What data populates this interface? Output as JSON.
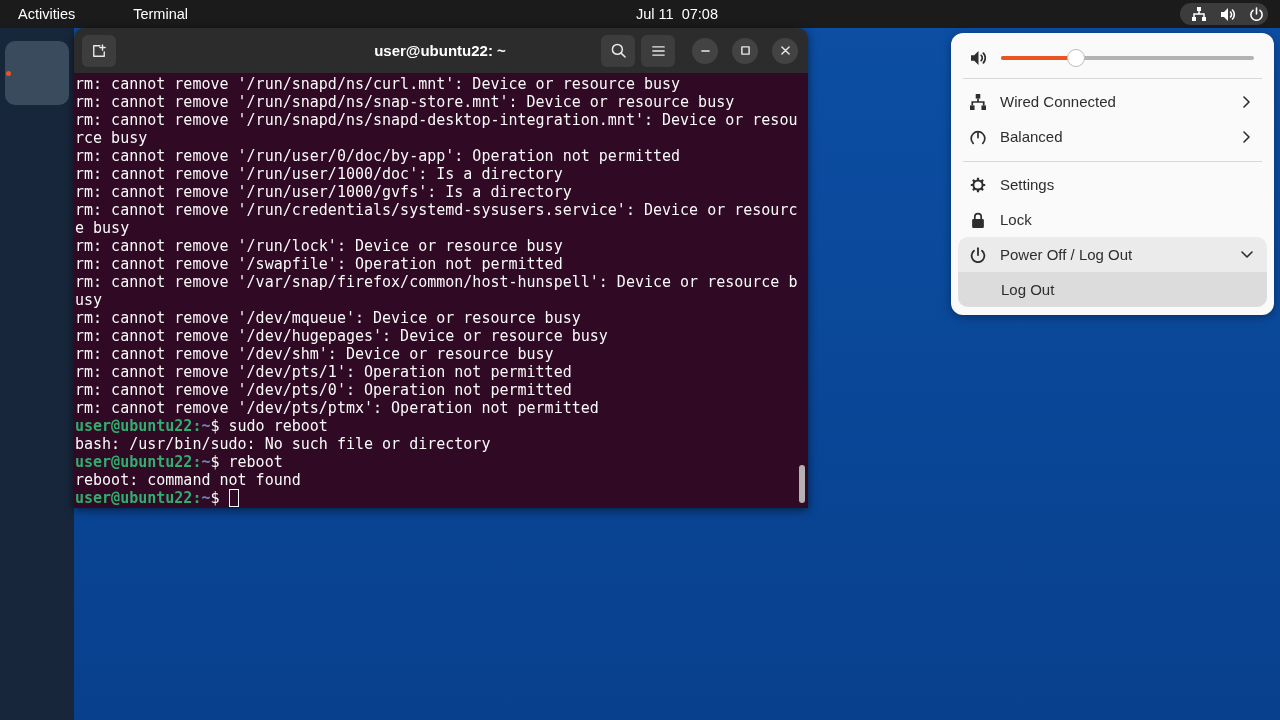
{
  "top_bar": {
    "activities": "Activities",
    "app_menu": "Terminal",
    "clock": "Jul 11  07:08",
    "indicators_active": true
  },
  "dock": {
    "items": [
      {
        "running": true
      }
    ]
  },
  "terminal": {
    "title": "user@ubuntu22: ~",
    "lines": [
      {
        "kind": "output",
        "text": "rm: cannot remove '/run/snapd/ns/curl.mnt': Device or resource busy"
      },
      {
        "kind": "output",
        "text": "rm: cannot remove '/run/snapd/ns/snap-store.mnt': Device or resource busy"
      },
      {
        "kind": "output",
        "text": "rm: cannot remove '/run/snapd/ns/snapd-desktop-integration.mnt': Device or resou"
      },
      {
        "kind": "output",
        "text": "rce busy"
      },
      {
        "kind": "output",
        "text": "rm: cannot remove '/run/user/0/doc/by-app': Operation not permitted"
      },
      {
        "kind": "output",
        "text": "rm: cannot remove '/run/user/1000/doc': Is a directory"
      },
      {
        "kind": "output",
        "text": "rm: cannot remove '/run/user/1000/gvfs': Is a directory"
      },
      {
        "kind": "output",
        "text": "rm: cannot remove '/run/credentials/systemd-sysusers.service': Device or resourc"
      },
      {
        "kind": "output",
        "text": "e busy"
      },
      {
        "kind": "output",
        "text": "rm: cannot remove '/run/lock': Device or resource busy"
      },
      {
        "kind": "output",
        "text": "rm: cannot remove '/swapfile': Operation not permitted"
      },
      {
        "kind": "output",
        "text": "rm: cannot remove '/var/snap/firefox/common/host-hunspell': Device or resource b"
      },
      {
        "kind": "output",
        "text": "usy"
      },
      {
        "kind": "output",
        "text": "rm: cannot remove '/dev/mqueue': Device or resource busy"
      },
      {
        "kind": "output",
        "text": "rm: cannot remove '/dev/hugepages': Device or resource busy"
      },
      {
        "kind": "output",
        "text": "rm: cannot remove '/dev/shm': Device or resource busy"
      },
      {
        "kind": "output",
        "text": "rm: cannot remove '/dev/pts/1': Operation not permitted"
      },
      {
        "kind": "output",
        "text": "rm: cannot remove '/dev/pts/0': Operation not permitted"
      },
      {
        "kind": "output",
        "text": "rm: cannot remove '/dev/pts/ptmx': Operation not permitted"
      },
      {
        "kind": "prompt",
        "user_host": "user@ubuntu22:",
        "path": "~",
        "input": "$ sudo reboot",
        "cursor": false
      },
      {
        "kind": "output",
        "text": "bash: /usr/bin/sudo: No such file or directory"
      },
      {
        "kind": "prompt",
        "user_host": "user@ubuntu22:",
        "path": "~",
        "input": "$ reboot",
        "cursor": false
      },
      {
        "kind": "output",
        "text": "reboot: command not found"
      },
      {
        "kind": "prompt",
        "user_host": "user@ubuntu22:",
        "path": "~",
        "input": "$",
        "cursor": true
      }
    ]
  },
  "quick_settings": {
    "volume": {
      "level": 0.28
    },
    "sections": [
      {
        "items": [
          {
            "kind": "submenu",
            "label": "Wired Connected"
          },
          {
            "kind": "submenu",
            "label": "Balanced"
          }
        ]
      },
      {
        "items": [
          {
            "kind": "action",
            "label": "Settings"
          },
          {
            "kind": "action",
            "label": "Lock"
          },
          {
            "kind": "expander",
            "label": "Power Off / Log Out",
            "expanded": true,
            "children": [
              {
                "label": "Log Out"
              }
            ]
          }
        ]
      }
    ]
  }
}
